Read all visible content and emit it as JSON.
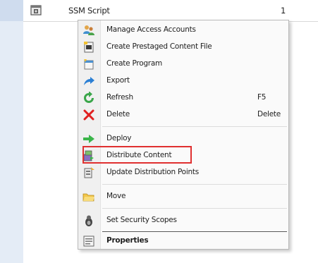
{
  "list": {
    "row_name": "SSM Script",
    "row_count": "1"
  },
  "menu": {
    "items": [
      {
        "label": "Manage Access Accounts",
        "icon": "users-icon",
        "shortcut": ""
      },
      {
        "label": "Create Prestaged Content File",
        "icon": "prestaged-file-icon",
        "shortcut": ""
      },
      {
        "label": "Create Program",
        "icon": "create-program-icon",
        "shortcut": ""
      },
      {
        "label": "Export",
        "icon": "export-arrow-icon",
        "shortcut": ""
      },
      {
        "label": "Refresh",
        "icon": "refresh-icon",
        "shortcut": "F5"
      },
      {
        "label": "Delete",
        "icon": "delete-x-icon",
        "shortcut": "Delete"
      },
      {
        "label": "Deploy",
        "icon": "deploy-arrow-icon",
        "shortcut": ""
      },
      {
        "label": "Distribute Content",
        "icon": "distribute-content-icon",
        "shortcut": ""
      },
      {
        "label": "Update Distribution Points",
        "icon": "update-dp-icon",
        "shortcut": ""
      },
      {
        "label": "Move",
        "icon": "folder-move-icon",
        "shortcut": ""
      },
      {
        "label": "Set Security Scopes",
        "icon": "security-scope-icon",
        "shortcut": ""
      },
      {
        "label": "Properties",
        "icon": "properties-icon",
        "shortcut": ""
      }
    ]
  },
  "colors": {
    "highlight_border": "#e03030",
    "menu_background": "#fafafa",
    "side_panel": "#e4ecf6"
  }
}
